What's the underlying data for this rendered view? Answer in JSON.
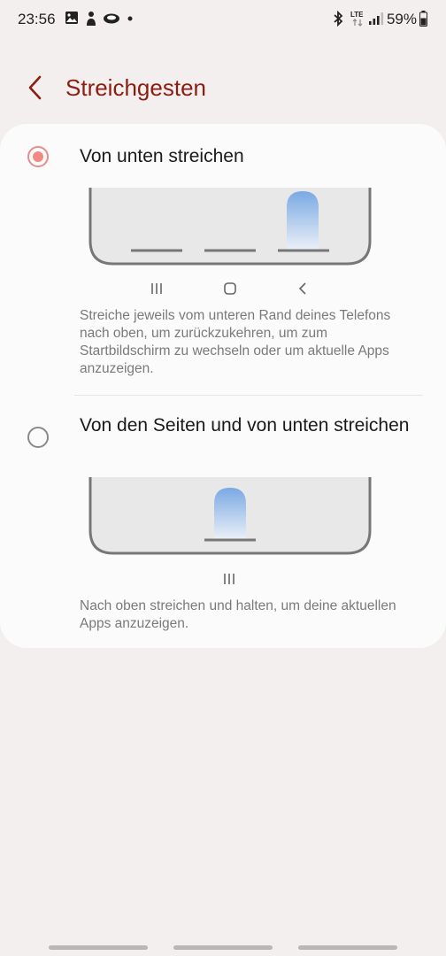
{
  "status_bar": {
    "time": "23:56",
    "battery": "59%",
    "network": "LTE"
  },
  "header": {
    "title": "Streichgesten"
  },
  "options": [
    {
      "label": "Von unten streichen",
      "selected": true,
      "description": "Streiche jeweils vom unteren Rand deines Telefons nach oben, um zurückzukehren, um zum Startbildschirm zu wechseln oder um aktuelle Apps anzuzeigen."
    },
    {
      "label": "Von den Seiten und von unten streichen",
      "selected": false,
      "description": "Nach oben streichen und halten, um deine aktuellen Apps anzuzeigen."
    }
  ],
  "colors": {
    "accent": "#8b1e13",
    "radio_selected": "#f08a83",
    "swipe_gradient": "#7aa9e3"
  },
  "icons": {
    "status": [
      "image-icon",
      "person-icon",
      "cloud-icon",
      "dot-icon",
      "bluetooth-icon",
      "lte-icon",
      "signal-icon"
    ],
    "nav": [
      "recents-icon",
      "home-icon",
      "back-icon"
    ]
  }
}
